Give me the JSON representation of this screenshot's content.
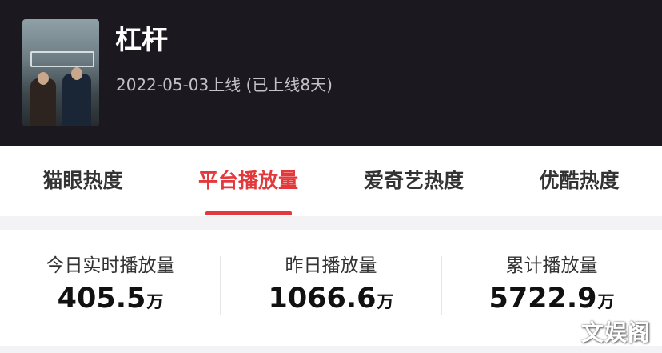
{
  "show": {
    "title": "杠杆",
    "release_info": "2022-05-03上线 (已上线8天)"
  },
  "tabs": [
    {
      "label": "猫眼热度",
      "active": false
    },
    {
      "label": "平台播放量",
      "active": true
    },
    {
      "label": "爱奇艺热度",
      "active": false
    },
    {
      "label": "优酷热度",
      "active": false
    }
  ],
  "stats": [
    {
      "label": "今日实时播放量",
      "value": "405.5",
      "unit": "万"
    },
    {
      "label": "昨日播放量",
      "value": "1066.6",
      "unit": "万"
    },
    {
      "label": "累计播放量",
      "value": "5722.9",
      "unit": "万"
    }
  ],
  "watermark": "文娱阁",
  "colors": {
    "header_bg": "#1b1820",
    "accent": "#e4393c",
    "page_bg": "#f3f3f5"
  }
}
